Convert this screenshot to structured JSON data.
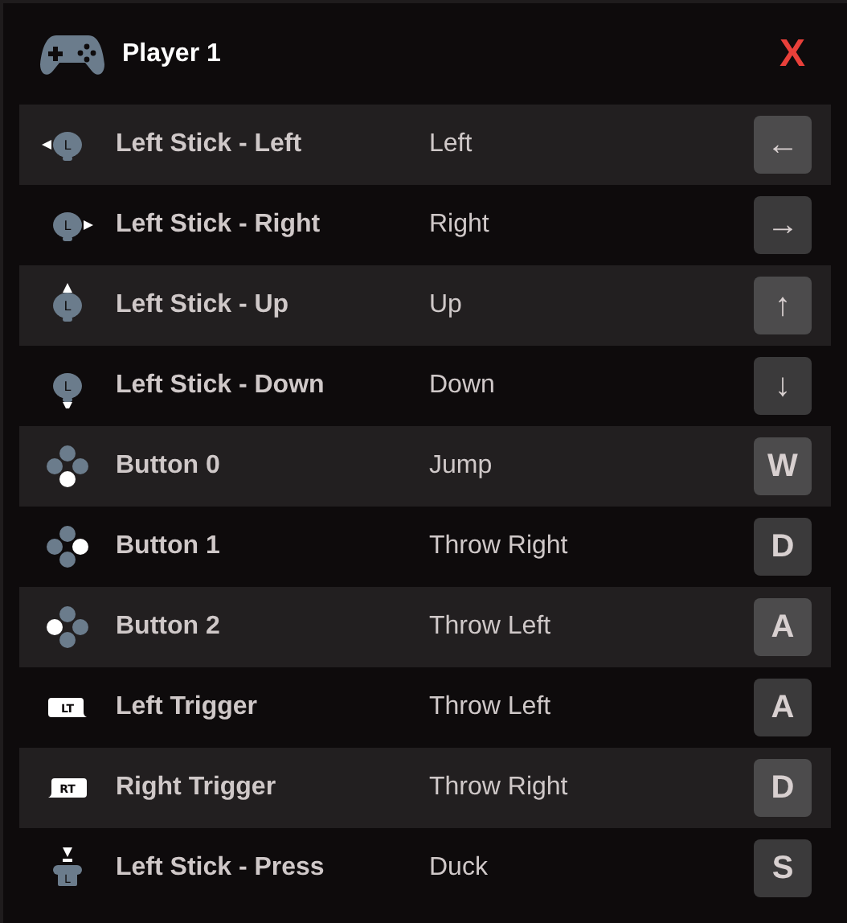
{
  "header": {
    "title": "Player 1",
    "close": "X"
  },
  "bindings": [
    {
      "icon": {
        "kind": "stick_left",
        "text": "L"
      },
      "input": "Left Stick - Left",
      "action": "Left",
      "key": "←"
    },
    {
      "icon": {
        "kind": "stick_right",
        "text": "L"
      },
      "input": "Left Stick - Right",
      "action": "Right",
      "key": "→"
    },
    {
      "icon": {
        "kind": "stick_up",
        "text": "L"
      },
      "input": "Left Stick - Up",
      "action": "Up",
      "key": "↑"
    },
    {
      "icon": {
        "kind": "stick_down",
        "text": "L"
      },
      "input": "Left Stick - Down",
      "action": "Down",
      "key": "↓"
    },
    {
      "icon": {
        "kind": "button_bottom"
      },
      "input": "Button 0",
      "action": "Jump",
      "key": "W"
    },
    {
      "icon": {
        "kind": "button_right"
      },
      "input": "Button 1",
      "action": "Throw Right",
      "key": "D"
    },
    {
      "icon": {
        "kind": "button_left"
      },
      "input": "Button 2",
      "action": "Throw Left",
      "key": "A"
    },
    {
      "icon": {
        "kind": "trigger_left",
        "text": "LT"
      },
      "input": "Left Trigger",
      "action": "Throw Left",
      "key": "A"
    },
    {
      "icon": {
        "kind": "trigger_right",
        "text": "RT"
      },
      "input": "Right Trigger",
      "action": "Throw Right",
      "key": "D"
    },
    {
      "icon": {
        "kind": "stick_press",
        "text": "L"
      },
      "input": "Left Stick - Press",
      "action": "Duck",
      "key": "S"
    }
  ]
}
